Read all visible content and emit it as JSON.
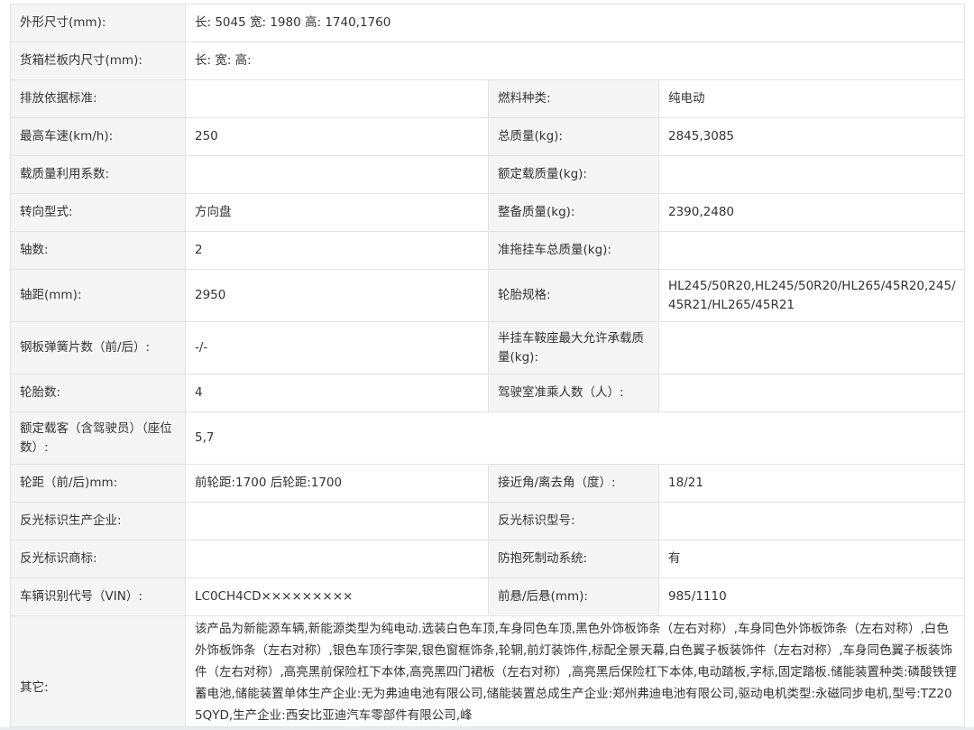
{
  "rows": {
    "dims": {
      "label": "外形尺寸(mm):",
      "value": "长: 5045 宽: 1980 高: 1740,1760"
    },
    "cargo": {
      "label": "货箱栏板内尺寸(mm):",
      "value": "长:  宽:  高:"
    },
    "emission": {
      "label": "排放依据标准:",
      "value": "",
      "label2": "燃料种类:",
      "value2": "纯电动"
    },
    "speed": {
      "label": "最高车速(km/h):",
      "value": "250",
      "label2": "总质量(kg):",
      "value2": "2845,3085"
    },
    "loadcoef": {
      "label": "载质量利用系数:",
      "value": "",
      "label2": "额定载质量(kg):",
      "value2": ""
    },
    "steering": {
      "label": "转向型式:",
      "value": "方向盘",
      "label2": "整备质量(kg):",
      "value2": "2390,2480"
    },
    "axles": {
      "label": "轴数:",
      "value": "2",
      "label2": "准拖挂车总质量(kg):",
      "value2": ""
    },
    "wheelbase": {
      "label": "轴距(mm):",
      "value": "2950",
      "label2": "轮胎规格:",
      "value2": "HL245/50R20,HL245/50R20/HL265/45R20,245/45R21/HL265/45R21"
    },
    "springs": {
      "label": "钢板弹簧片数（前/后）:",
      "value": "-/-",
      "label2": "半挂车鞍座最大允许承载质量(kg):",
      "value2": ""
    },
    "tires": {
      "label": "轮胎数:",
      "value": "4",
      "label2": "驾驶室准乘人数（人）:",
      "value2": ""
    },
    "seats": {
      "label": "额定载客（含驾驶员）（座位数）:",
      "value": "5,7"
    },
    "track": {
      "label": "轮距（前/后)mm:",
      "value": "前轮距:1700 后轮距:1700",
      "label2": "接近角/离去角（度）:",
      "value2": "18/21"
    },
    "reflect_maker": {
      "label": "反光标识生产企业:",
      "value": "",
      "label2": "反光标识型号:",
      "value2": ""
    },
    "reflect_brand": {
      "label": "反光标识商标:",
      "value": "",
      "label2": "防抱死制动系统:",
      "value2": "有"
    },
    "vin": {
      "label": "车辆识别代号（VIN）:",
      "value": "LC0CH4CD×××××××××",
      "label2": "前悬/后悬(mm):",
      "value2": "985/1110"
    },
    "other": {
      "label": "其它:",
      "value": "该产品为新能源车辆,新能源类型为纯电动.选装白色车顶,车身同色车顶,黑色外饰板饰条（左右对称）,车身同色外饰板饰条（左右对称）,白色外饰板饰条（左右对称）,银色车顶行李架,银色窗框饰条,轮辋,前灯装饰件,标配全景天幕,白色翼子板装饰件（左右对称）,车身同色翼子板装饰件（左右对称）,高亮黑前保险杠下本体,高亮黑四门裙板（左右对称）,高亮黑后保险杠下本体,电动踏板,字标,固定踏板.储能装置种类:磷酸铁锂蓄电池,储能装置单体生产企业:无为弗迪电池有限公司,储能装置总成生产企业:郑州弗迪电池有限公司,驱动电机类型:永磁同步电机,型号:TZ205QYD,生产企业:西安比亚迪汽车零部件有限公司,峰"
    }
  }
}
